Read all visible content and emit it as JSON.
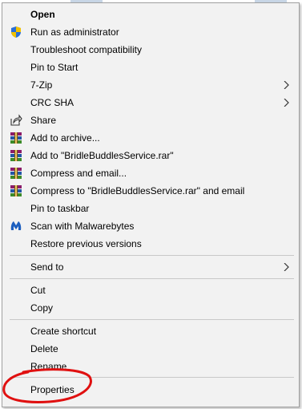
{
  "menu": {
    "items": [
      {
        "label": "Open",
        "bold": true
      },
      {
        "label": "Run as administrator",
        "icon": "shield-icon"
      },
      {
        "label": "Troubleshoot compatibility"
      },
      {
        "label": "Pin to Start"
      },
      {
        "label": "7-Zip",
        "submenu": true
      },
      {
        "label": "CRC SHA",
        "submenu": true
      },
      {
        "label": "Share",
        "icon": "share-icon"
      },
      {
        "label": "Add to archive...",
        "icon": "winrar-icon"
      },
      {
        "label": "Add to \"BridleBuddlesService.rar\"",
        "icon": "winrar-icon"
      },
      {
        "label": "Compress and email...",
        "icon": "winrar-icon"
      },
      {
        "label": "Compress to \"BridleBuddlesService.rar\" and email",
        "icon": "winrar-icon"
      },
      {
        "label": "Pin to taskbar"
      },
      {
        "label": "Scan with Malwarebytes",
        "icon": "malwarebytes-icon"
      },
      {
        "label": "Restore previous versions"
      },
      {
        "label": "Send to",
        "submenu": true
      },
      {
        "label": "Cut"
      },
      {
        "label": "Copy"
      },
      {
        "label": "Create shortcut"
      },
      {
        "label": "Delete"
      },
      {
        "label": "Rename"
      },
      {
        "label": "Properties"
      }
    ]
  },
  "colors": {
    "menu_bg": "#f2f2f2",
    "annotation": "#e01010",
    "shield_blue": "#2a6fd6",
    "shield_yellow": "#f2c200"
  }
}
